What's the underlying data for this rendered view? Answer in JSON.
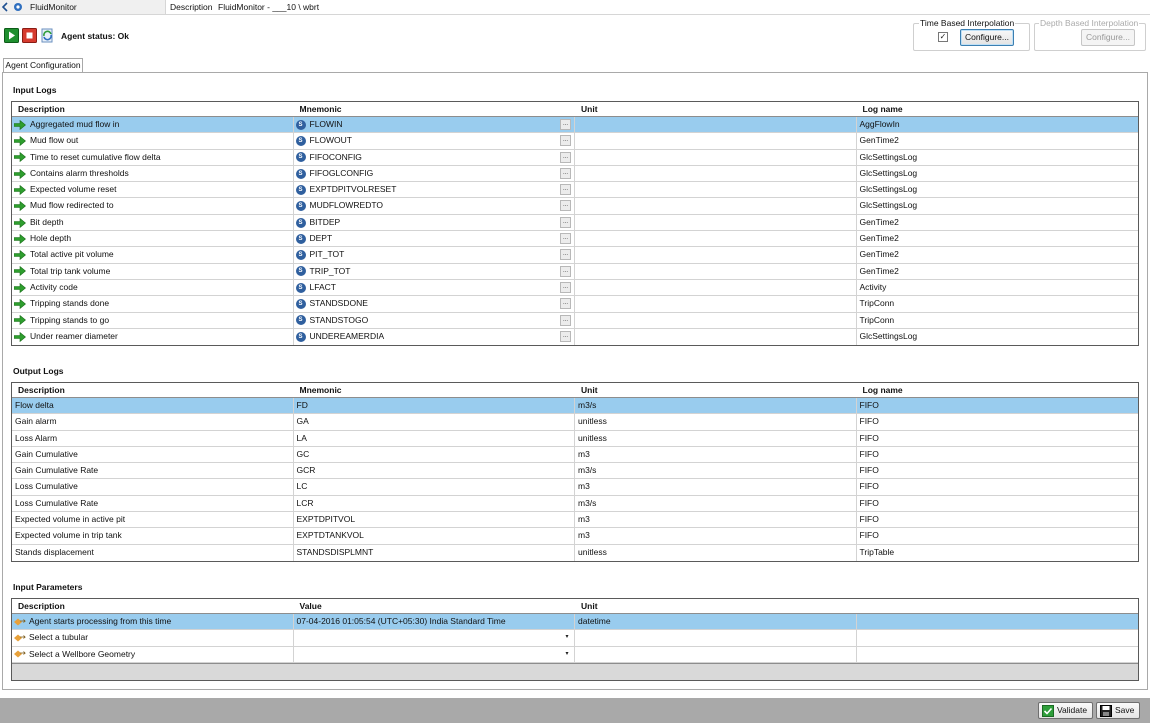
{
  "titlebar": {
    "app_name": "FluidMonitor",
    "description_label": "Description",
    "description_value": "FluidMonitor - ___10 \\ wbrt"
  },
  "toolbar": {
    "agent_status": "Agent status: Ok",
    "time_interp": {
      "label": "Time Based Interpolation",
      "checked": true,
      "checkmark": "✓",
      "configure": "Configure..."
    },
    "depth_interp": {
      "label": "Depth Based Interpolation",
      "configure": "Configure..."
    }
  },
  "tab": {
    "label": "Agent Configuration"
  },
  "input_logs": {
    "title": "Input Logs",
    "headers": [
      "Description",
      "Mnemonic",
      "Unit",
      "Log name"
    ],
    "rows": [
      {
        "description": "Aggregated mud flow in",
        "mnemonic": "FLOWIN",
        "unit": "",
        "log": "AggFlowIn"
      },
      {
        "description": "Mud flow out",
        "mnemonic": "FLOWOUT",
        "unit": "",
        "log": "GenTime2"
      },
      {
        "description": "Time to reset cumulative flow delta",
        "mnemonic": "FIFOCONFIG",
        "unit": "",
        "log": "GlcSettingsLog"
      },
      {
        "description": "Contains alarm thresholds",
        "mnemonic": "FIFOGLCONFIG",
        "unit": "",
        "log": "GlcSettingsLog"
      },
      {
        "description": "Expected volume reset",
        "mnemonic": "EXPTDPITVOLRESET",
        "unit": "",
        "log": "GlcSettingsLog"
      },
      {
        "description": "Mud flow redirected to",
        "mnemonic": "MUDFLOWREDTO",
        "unit": "",
        "log": "GlcSettingsLog"
      },
      {
        "description": "Bit depth",
        "mnemonic": "BITDEP",
        "unit": "",
        "log": "GenTime2"
      },
      {
        "description": "Hole depth",
        "mnemonic": "DEPT",
        "unit": "",
        "log": "GenTime2"
      },
      {
        "description": "Total active pit volume",
        "mnemonic": "PIT_TOT",
        "unit": "",
        "log": "GenTime2"
      },
      {
        "description": "Total trip tank volume",
        "mnemonic": "TRIP_TOT",
        "unit": "",
        "log": "GenTime2"
      },
      {
        "description": "Activity code",
        "mnemonic": "LFACT",
        "unit": "",
        "log": "Activity"
      },
      {
        "description": "Tripping stands done",
        "mnemonic": "STANDSDONE",
        "unit": "",
        "log": "TripConn"
      },
      {
        "description": "Tripping stands to go",
        "mnemonic": "STANDSTOGO",
        "unit": "",
        "log": "TripConn"
      },
      {
        "description": "Under reamer diameter",
        "mnemonic": "UNDEREAMERDIA",
        "unit": "",
        "log": "GlcSettingsLog"
      }
    ]
  },
  "output_logs": {
    "title": "Output Logs",
    "headers": [
      "Description",
      "Mnemonic",
      "Unit",
      "Log name"
    ],
    "rows": [
      {
        "description": "Flow delta",
        "mnemonic": "FD",
        "unit": "m3/s",
        "log": "FIFO"
      },
      {
        "description": "Gain alarm",
        "mnemonic": "GA",
        "unit": "unitless",
        "log": "FIFO"
      },
      {
        "description": "Loss Alarm",
        "mnemonic": "LA",
        "unit": "unitless",
        "log": "FIFO"
      },
      {
        "description": "Gain Cumulative",
        "mnemonic": "GC",
        "unit": "m3",
        "log": "FIFO"
      },
      {
        "description": "Gain Cumulative Rate",
        "mnemonic": "GCR",
        "unit": "m3/s",
        "log": "FIFO"
      },
      {
        "description": "Loss Cumulative",
        "mnemonic": "LC",
        "unit": "m3",
        "log": "FIFO"
      },
      {
        "description": "Loss Cumulative Rate",
        "mnemonic": "LCR",
        "unit": "m3/s",
        "log": "FIFO"
      },
      {
        "description": "Expected volume in active pit",
        "mnemonic": "EXPTDPITVOL",
        "unit": "m3",
        "log": "FIFO"
      },
      {
        "description": "Expected volume in trip tank",
        "mnemonic": "EXPTDTANKVOL",
        "unit": "m3",
        "log": "FIFO"
      },
      {
        "description": "Stands displacement",
        "mnemonic": "STANDSDISPLMNT",
        "unit": "unitless",
        "log": "TripTable"
      }
    ]
  },
  "input_params": {
    "title": "Input Parameters",
    "headers": [
      "Description",
      "Value",
      "Unit",
      ""
    ],
    "rows": [
      {
        "description": "Agent starts processing from this time",
        "value": "07-04-2016 01:05:54 (UTC+05:30) India Standard Time",
        "unit": "datetime",
        "dropdown": false
      },
      {
        "description": "Select a tubular",
        "value": "",
        "unit": "",
        "dropdown": true
      },
      {
        "description": "Select a Wellbore Geometry",
        "value": "",
        "unit": "",
        "dropdown": true
      }
    ]
  },
  "bottom": {
    "validate": "Validate",
    "save": "Save"
  },
  "icons": {
    "mnemonic_badge": "S",
    "ellipsis": "...",
    "dropdown_arrow": "▾"
  },
  "colors": {
    "selected_row": "#99ccee",
    "arrow_green": "#2e9e2e",
    "bottom_bar": "#a9a9a9"
  }
}
